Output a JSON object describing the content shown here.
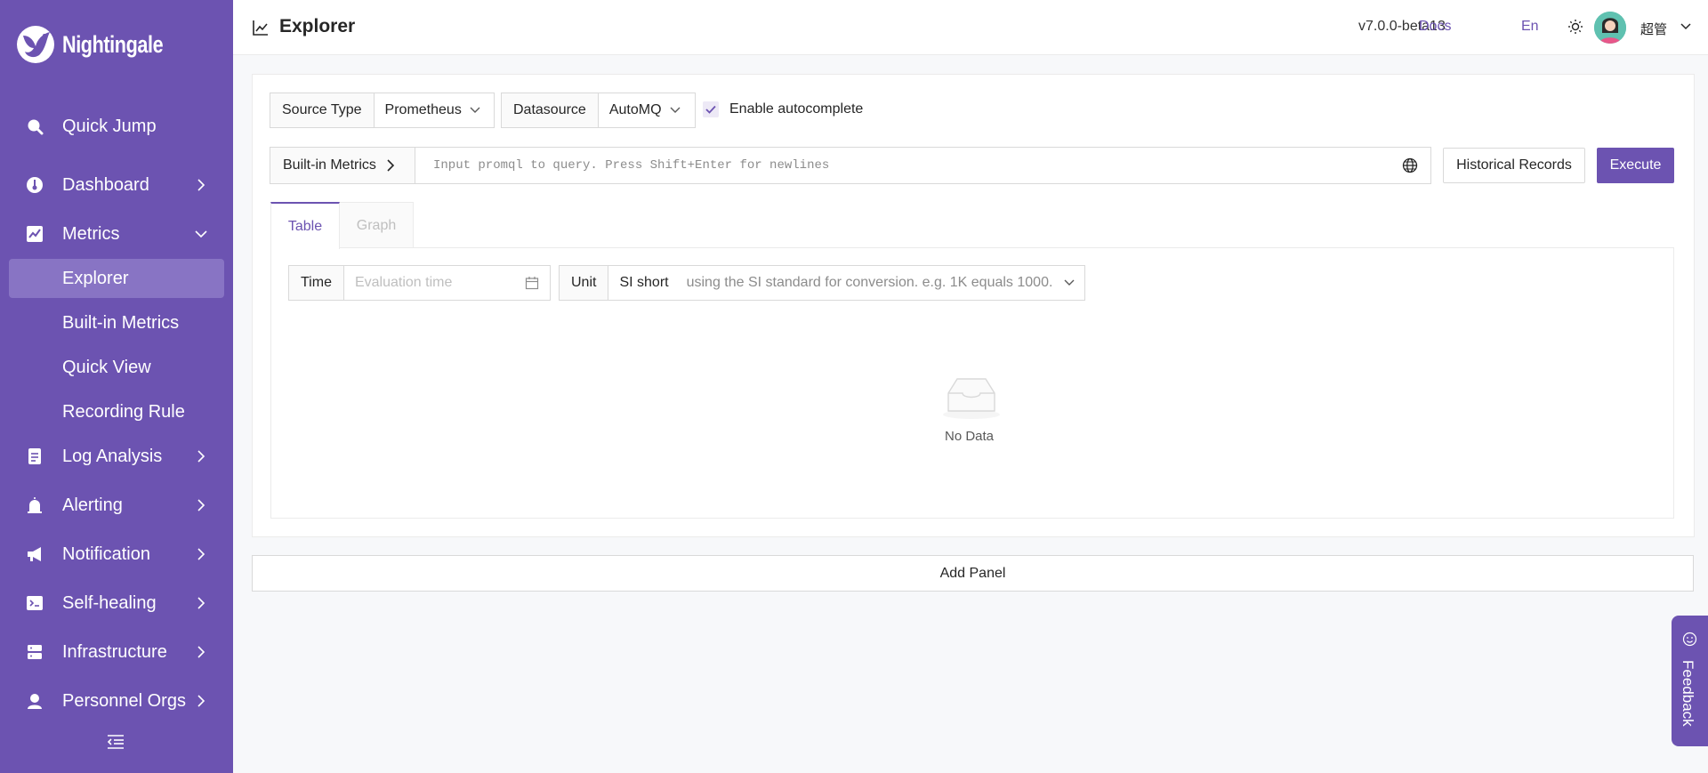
{
  "app": {
    "logo_text": "Nightingale"
  },
  "sidebar": {
    "items": [
      {
        "label": "Quick Jump"
      },
      {
        "label": "Dashboard"
      },
      {
        "label": "Metrics"
      },
      {
        "label": "Log Analysis"
      },
      {
        "label": "Alerting"
      },
      {
        "label": "Notification"
      },
      {
        "label": "Self-healing"
      },
      {
        "label": "Infrastructure"
      },
      {
        "label": "Personnel Orgs"
      }
    ],
    "metrics_sub": [
      {
        "label": "Explorer",
        "active": true
      },
      {
        "label": "Built-in Metrics"
      },
      {
        "label": "Quick View"
      },
      {
        "label": "Recording Rule"
      }
    ]
  },
  "header": {
    "title": "Explorer",
    "version": "v7.0.0-beta13",
    "docs": "Docs",
    "lang": "En",
    "user": "超管"
  },
  "query": {
    "source_type_label": "Source Type",
    "source_type_value": "Prometheus",
    "datasource_label": "Datasource",
    "datasource_value": "AutoMQ",
    "autocomplete_label": "Enable autocomplete",
    "autocomplete_checked": true,
    "builtin_metrics": "Built-in Metrics",
    "placeholder": "Input promql to query. Press Shift+Enter for newlines",
    "history_button": "Historical Records",
    "execute_button": "Execute"
  },
  "tabs": [
    {
      "label": "Table",
      "active": true
    },
    {
      "label": "Graph",
      "active": false
    }
  ],
  "table_panel": {
    "time_label": "Time",
    "time_placeholder": "Evaluation time",
    "unit_label": "Unit",
    "unit_value": "SI short",
    "unit_description": "using the SI standard for conversion. e.g. 1K equals 1000.",
    "empty_text": "No Data"
  },
  "add_panel": "Add Panel",
  "feedback": "Feedback",
  "colors": {
    "brand": "#6c53b1",
    "sidebar_active": "#8874c4"
  }
}
